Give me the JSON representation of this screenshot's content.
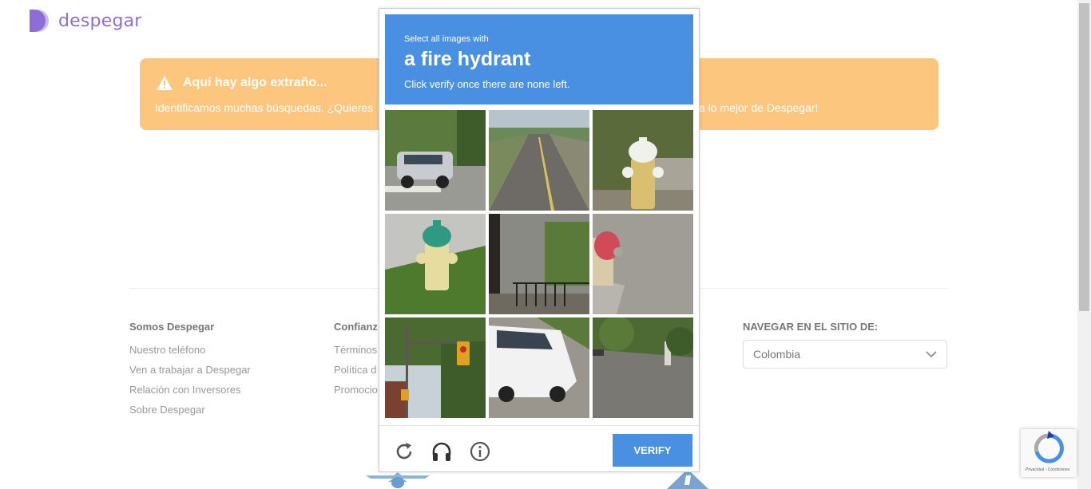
{
  "header": {
    "logo_text": "despegar"
  },
  "banner": {
    "title": "Aquí hay algo extraño...",
    "message_left": "Identificamos muchas búsquedas. ¿Quieres",
    "message_right": "a lo mejor de Despegar!"
  },
  "footer": {
    "col1": {
      "heading": "Somos Despegar",
      "links": [
        "Nuestro teléfono",
        "Ven a trabajar a Despegar",
        "Relación con Inversores",
        "Sobre Despegar"
      ]
    },
    "col2": {
      "heading": "Confianz",
      "links": [
        "Términos",
        "Política d",
        "Promocio"
      ]
    },
    "site": {
      "heading": "NAVEGAR EN EL SITIO DE:",
      "selected": "Colombia"
    }
  },
  "captcha": {
    "instruction": "Select all images with",
    "object": "a fire hydrant",
    "hint": "Click verify once there are none left.",
    "verify_label": "VERIFY",
    "tiles": [
      {
        "id": 1,
        "content": "car-street"
      },
      {
        "id": 2,
        "content": "road"
      },
      {
        "id": 3,
        "content": "fire-hydrant"
      },
      {
        "id": 4,
        "content": "fire-hydrant"
      },
      {
        "id": 5,
        "content": "building-fence"
      },
      {
        "id": 6,
        "content": "fire-hydrant"
      },
      {
        "id": 7,
        "content": "traffic-light"
      },
      {
        "id": 8,
        "content": "car"
      },
      {
        "id": 9,
        "content": "street-trees"
      }
    ]
  },
  "recaptcha_badge": {
    "text": "Privacidad - Condiciones"
  },
  "colors": {
    "accent": "#4a90e2",
    "banner": "#fcc67f",
    "brand": "#8e6ddb"
  }
}
